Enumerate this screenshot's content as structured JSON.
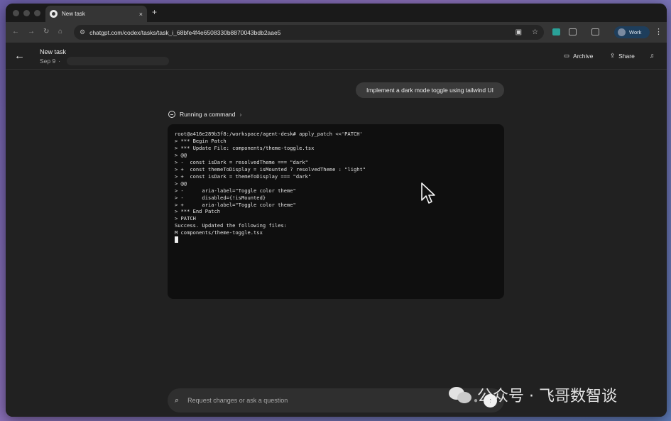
{
  "browser": {
    "tab_title": "New task",
    "tab_close": "×",
    "new_tab": "+",
    "url": "chatgpt.com/codex/tasks/task_i_68bfe4f4e6508330b8870043bdb2aae5",
    "profile_name": "Work"
  },
  "header": {
    "task_title": "New task",
    "task_date": "Sep 9",
    "date_separator": "·",
    "archive_label": "Archive",
    "share_label": "Share"
  },
  "chat": {
    "user_message": "Implement a dark mode toggle using tailwind UI",
    "status_label": "Running a command"
  },
  "terminal": {
    "lines": [
      "root@a416e289b3f8:/workspace/agent-desk# apply_patch <<'PATCH'",
      "> *** Begin Patch",
      "> *** Update File: components/theme-toggle.tsx",
      "> @@",
      "> -  const isDark = resolvedTheme === \"dark\"",
      "> +  const themeToDisplay = isMounted ? resolvedTheme : \"light\"",
      "> +  const isDark = themeToDisplay === \"dark\"",
      "> @@",
      "> -      aria-label=\"Toggle color theme\"",
      "> -      disabled={!isMounted}",
      "> +      aria-label=\"Toggle color theme\"",
      "> *** End Patch",
      "> PATCH",
      "Success. Updated the following files:",
      "M components/theme-toggle.tsx"
    ]
  },
  "composer": {
    "placeholder": "Request changes or ask a question"
  },
  "watermark": {
    "text": "公众号 · 飞哥数智谈"
  },
  "colors": {
    "app_bg": "#212121",
    "terminal_bg": "#0f0f0f",
    "bubble_bg": "#3a3a3a",
    "profile_bg": "#1e3e5c"
  },
  "icons": [
    "back-arrow-icon",
    "reload-icon",
    "home-icon",
    "star-icon",
    "extensions-icon",
    "archive-icon",
    "share-icon",
    "bell-icon",
    "paperclip-icon",
    "mic-icon",
    "send-icon",
    "spinner-icon",
    "mouse-pointer-icon"
  ]
}
